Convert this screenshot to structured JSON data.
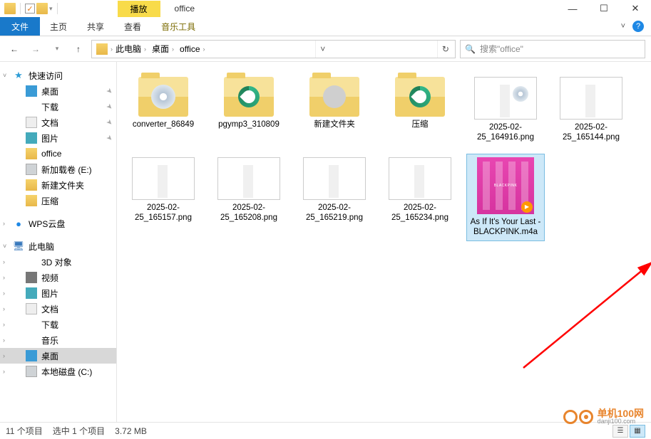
{
  "titlebar": {
    "play_tab": "播放",
    "window_title": "office"
  },
  "ribbon": {
    "file": "文件",
    "tabs": [
      "主页",
      "共享",
      "查看",
      "音乐工具"
    ]
  },
  "address": {
    "crumbs": [
      "此电脑",
      "桌面",
      "office"
    ],
    "search_placeholder": "搜索\"office\""
  },
  "tree": {
    "quick_access": "快速访问",
    "qa_items": [
      {
        "label": "桌面",
        "ico": "desk",
        "pin": true
      },
      {
        "label": "下载",
        "ico": "dl",
        "pin": true
      },
      {
        "label": "文档",
        "ico": "doc",
        "pin": true
      },
      {
        "label": "图片",
        "ico": "pic",
        "pin": true
      },
      {
        "label": "office",
        "ico": "folder",
        "pin": false
      },
      {
        "label": "新加载卷 (E:)",
        "ico": "drive",
        "pin": false
      },
      {
        "label": "新建文件夹",
        "ico": "folder",
        "pin": false
      },
      {
        "label": "压缩",
        "ico": "folder",
        "pin": false
      }
    ],
    "wps": "WPS云盘",
    "this_pc": "此电脑",
    "pc_items": [
      {
        "label": "3D 对象",
        "ico": "three"
      },
      {
        "label": "视频",
        "ico": "vid"
      },
      {
        "label": "图片",
        "ico": "pic"
      },
      {
        "label": "文档",
        "ico": "doc"
      },
      {
        "label": "下载",
        "ico": "dl"
      },
      {
        "label": "音乐",
        "ico": "mus"
      },
      {
        "label": "桌面",
        "ico": "desk",
        "selected": true
      },
      {
        "label": "本地磁盘 (C:)",
        "ico": "drive"
      }
    ]
  },
  "files": [
    {
      "name": "converter_86849",
      "type": "folder",
      "inner": "disc"
    },
    {
      "name": "pgymp3_310809",
      "type": "folder",
      "inner": "edge"
    },
    {
      "name": "新建文件夹",
      "type": "folder",
      "inner": "gear"
    },
    {
      "name": "压缩",
      "type": "folder",
      "inner": "edge"
    },
    {
      "name": "2025-02-25_164916.png",
      "type": "png",
      "disc": true
    },
    {
      "name": "2025-02-25_165144.png",
      "type": "png"
    },
    {
      "name": "2025-02-25_165157.png",
      "type": "png"
    },
    {
      "name": "2025-02-25_165208.png",
      "type": "png"
    },
    {
      "name": "2025-02-25_165219.png",
      "type": "png"
    },
    {
      "name": "2025-02-25_165234.png",
      "type": "png"
    },
    {
      "name": "As If It's Your Last - BLACKPINK.m4a",
      "type": "audio",
      "selected": true
    }
  ],
  "status": {
    "count": "11 个项目",
    "selection": "选中 1 个项目",
    "size": "3.72 MB"
  },
  "watermark": {
    "line1": "单机100网",
    "line2": "danji100.com"
  }
}
